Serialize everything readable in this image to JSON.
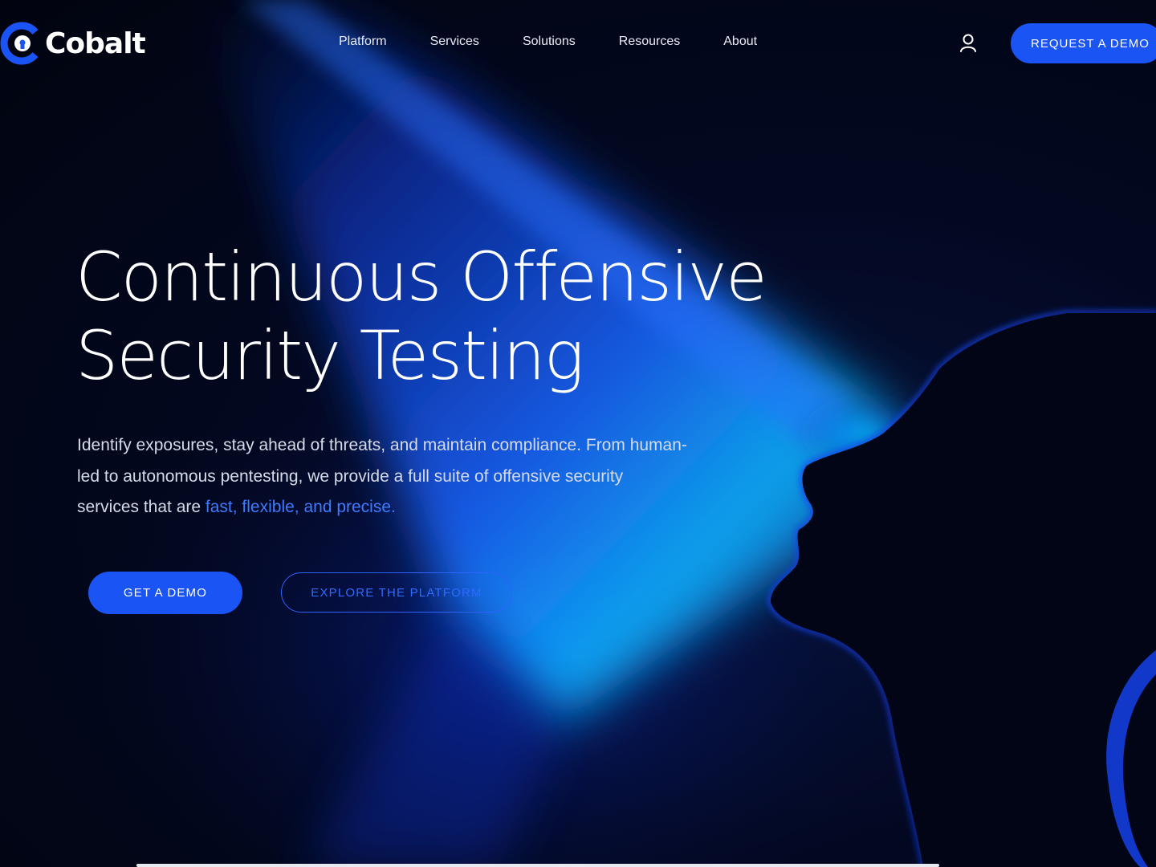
{
  "brand": {
    "name": "Cobalt",
    "accent_color": "#1a54f5",
    "link_color": "#3f7bff"
  },
  "nav": {
    "items": [
      {
        "label": "Platform"
      },
      {
        "label": "Services"
      },
      {
        "label": "Solutions"
      },
      {
        "label": "Resources"
      },
      {
        "label": "About"
      }
    ],
    "user_icon": "user-icon",
    "cta": "REQUEST A DEMO"
  },
  "hero": {
    "title_line1": "Continuous Offensive",
    "title_line2": "Security Testing",
    "description_lead": "Identify exposures, stay ahead of threats, and maintain compliance. From human-led to autonomous pentesting, we provide a full suite of offensive security services that are ",
    "description_accent": "fast, flexible, and precise.",
    "primary_cta": "GET A DEMO",
    "secondary_cta": "EXPLORE THE PLATFORM"
  }
}
